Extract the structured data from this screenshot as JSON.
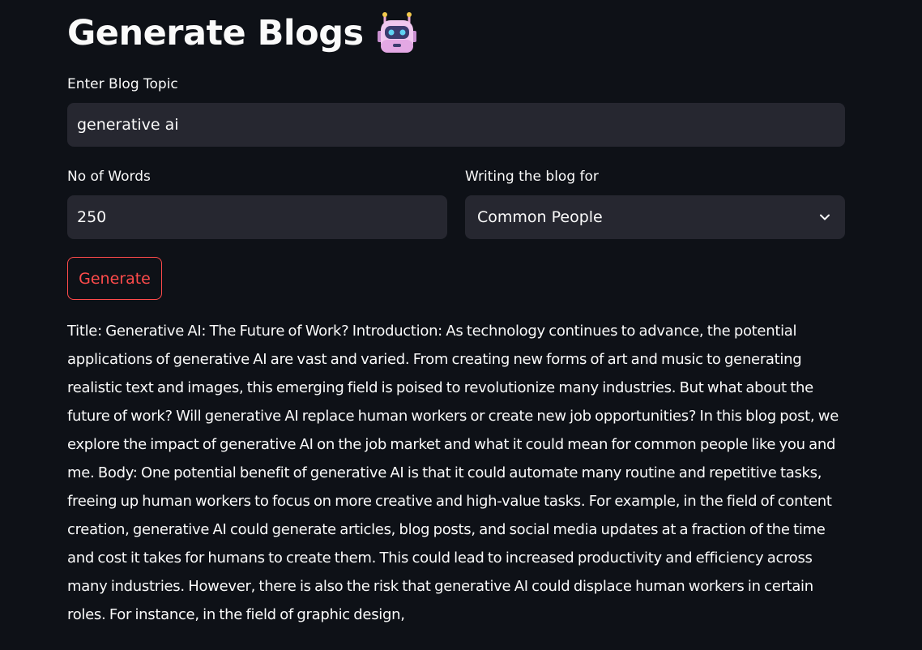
{
  "page": {
    "title": "Generate Blogs",
    "title_icon": "robot-face-icon"
  },
  "form": {
    "topic": {
      "label": "Enter Blog Topic",
      "value": "generative ai"
    },
    "words": {
      "label": "No of Words",
      "value": "250"
    },
    "audience": {
      "label": "Writing the blog for",
      "selected": "Common People",
      "icon": "chevron-down-icon"
    },
    "generate_label": "Generate"
  },
  "output": {
    "text": "Title: Generative AI: The Future of Work? Introduction: As technology continues to advance, the potential applications of generative AI are vast and varied. From creating new forms of art and music to generating realistic text and images, this emerging field is poised to revolutionize many industries. But what about the future of work? Will generative AI replace human workers or create new job opportunities? In this blog post, we explore the impact of generative AI on the job market and what it could mean for common people like you and me. Body: One potential benefit of generative AI is that it could automate many routine and repetitive tasks, freeing up human workers to focus on more creative and high-value tasks. For example, in the field of content creation, generative AI could generate articles, blog posts, and social media updates at a fraction of the time and cost it takes for humans to create them. This could lead to increased productivity and efficiency across many industries. However, there is also the risk that generative AI could displace human workers in certain roles. For instance, in the field of graphic design,"
  },
  "colors": {
    "background": "#0e1117",
    "input_bg": "#262730",
    "accent": "#ff4b4b",
    "text": "#fafafa"
  }
}
